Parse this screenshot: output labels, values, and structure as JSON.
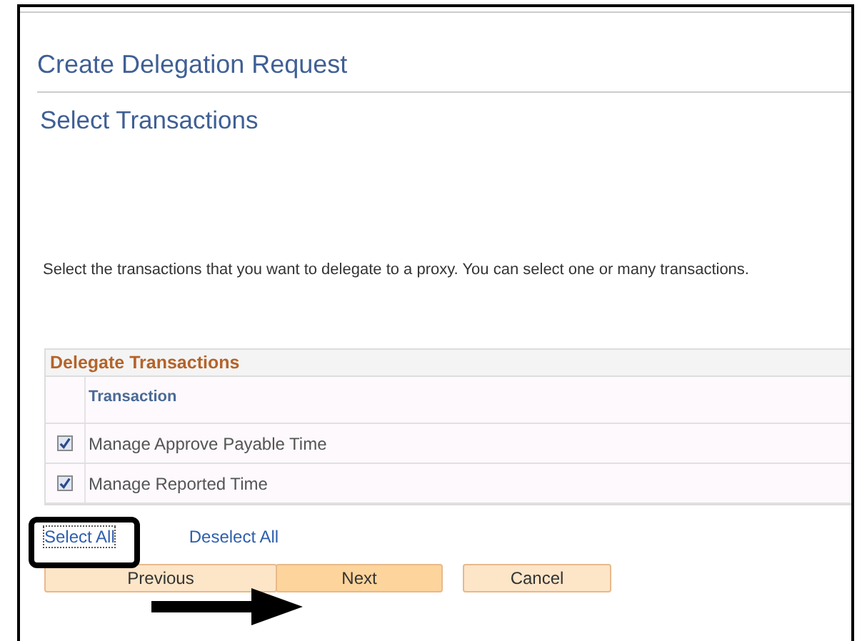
{
  "page_title": "Create Delegation Request",
  "step_title": "Select Transactions",
  "instructions": "Select the transactions that you want to delegate to a proxy. You can select one or many transactions.",
  "grid": {
    "title": "Delegate Transactions",
    "columns": [
      "Transaction"
    ],
    "rows": [
      {
        "transaction": "Manage Approve Payable Time",
        "checked": true
      },
      {
        "transaction": "Manage Reported Time",
        "checked": true
      }
    ]
  },
  "links": [
    "Select All",
    "Deselect All"
  ],
  "buttons": [
    {
      "label": "Previous",
      "primary": false
    },
    {
      "label": "Next",
      "primary": true
    },
    {
      "label": "Cancel",
      "primary": false
    }
  ]
}
